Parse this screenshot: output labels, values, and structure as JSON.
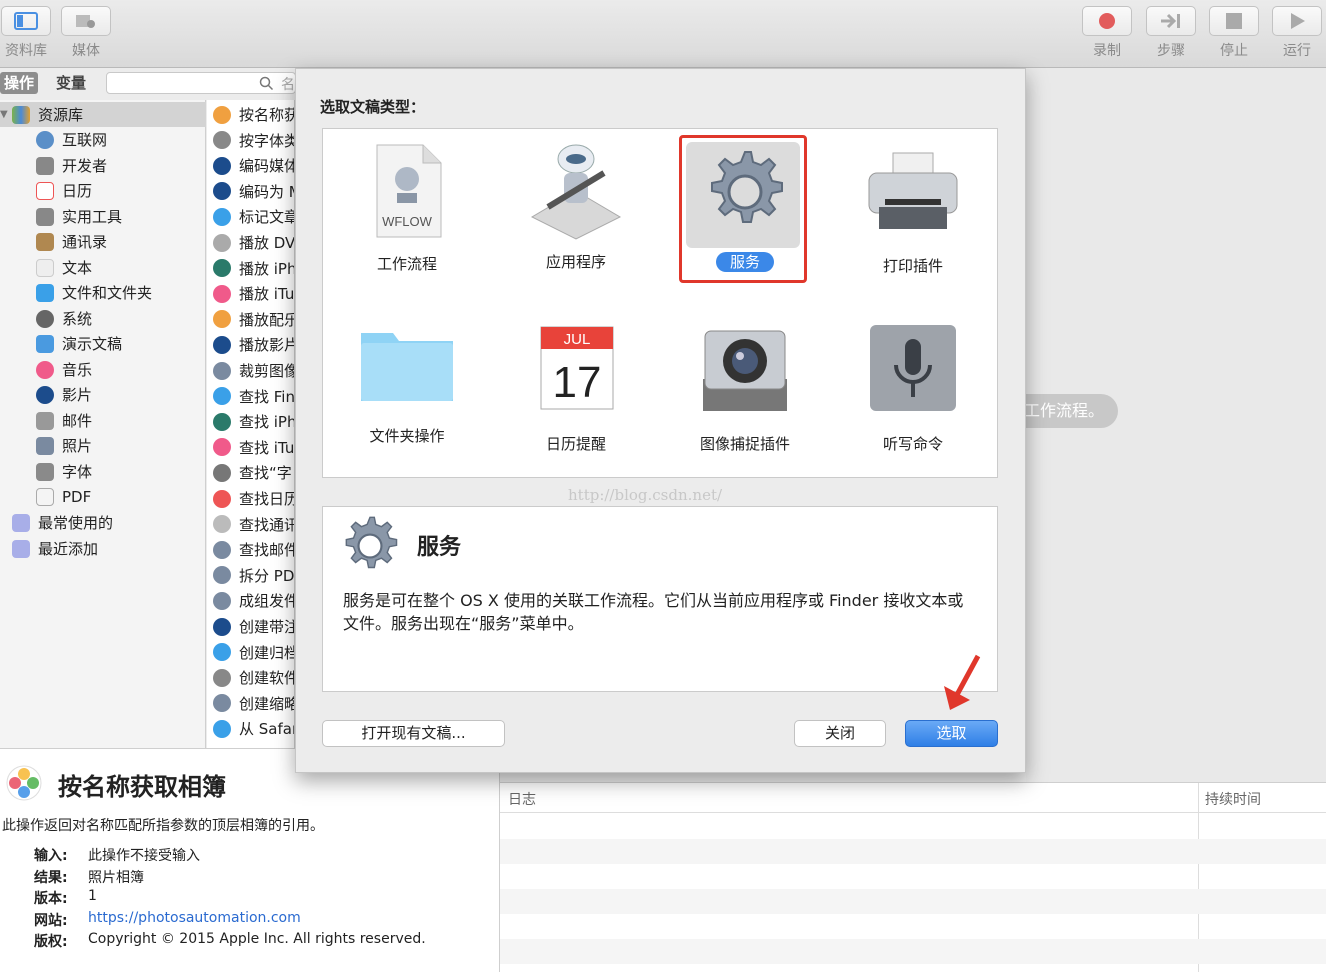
{
  "toolbar": {
    "left": [
      {
        "label": "资料库",
        "icon": "library-icon"
      },
      {
        "label": "媒体",
        "icon": "media-icon"
      }
    ],
    "right": [
      {
        "label": "录制",
        "icon": "record-icon"
      },
      {
        "label": "步骤",
        "icon": "step-icon"
      },
      {
        "label": "停止",
        "icon": "stop-icon"
      },
      {
        "label": "运行",
        "icon": "run-icon"
      }
    ]
  },
  "tabs": {
    "actions": "操作",
    "variables": "变量",
    "search_placeholder": "名"
  },
  "library": {
    "root": "资源库",
    "items": [
      "互联网",
      "开发者",
      "日历",
      "实用工具",
      "通讯录",
      "文本",
      "文件和文件夹",
      "系统",
      "演示文稿",
      "音乐",
      "影片",
      "邮件",
      "照片",
      "字体",
      "PDF"
    ],
    "groups": [
      "最常使用的",
      "最近添加"
    ]
  },
  "actions": [
    "按名称获",
    "按字体类",
    "编码媒体",
    "编码为 M",
    "标记文章",
    "播放 DV",
    "播放 iPh",
    "播放 iTu",
    "播放配乐",
    "播放影片",
    "裁剪图像",
    "查找 Fin",
    "查找 iPh",
    "查找 iTu",
    "查找“字",
    "查找日历",
    "查找通讯",
    "查找邮件",
    "拆分 PD",
    "成组发件",
    "创建带注",
    "创建归档",
    "创建软件",
    "创建缩略",
    "从 Safar"
  ],
  "info": {
    "title": "按名称获取相簿",
    "description": "此操作返回对名称匹配所指参数的顶层相簿的引用。",
    "rows": [
      {
        "key": "输入:",
        "value": "此操作不接受输入"
      },
      {
        "key": "结果:",
        "value": "照片相簿"
      },
      {
        "key": "版本:",
        "value": "1"
      },
      {
        "key": "网站:",
        "value": "https://photosautomation.com"
      },
      {
        "key": "版权:",
        "value": "Copyright © 2015 Apple Inc. All rights reserved."
      }
    ]
  },
  "log": {
    "col_log": "日志",
    "col_duration": "持续时间"
  },
  "main": {
    "hint": "工作流程。"
  },
  "sheet": {
    "heading": "选取文稿类型：",
    "types": [
      {
        "label": "工作流程",
        "icon": "workflow-document-icon",
        "badge": "WFLOW"
      },
      {
        "label": "应用程序",
        "icon": "automator-robot-icon"
      },
      {
        "label": "服务",
        "icon": "gear-icon",
        "selected": true
      },
      {
        "label": "打印插件",
        "icon": "printer-icon"
      },
      {
        "label": "文件夹操作",
        "icon": "folder-icon"
      },
      {
        "label": "日历提醒",
        "icon": "calendar-icon",
        "month": "JUL",
        "day": "17"
      },
      {
        "label": "图像捕捉插件",
        "icon": "camera-icon"
      },
      {
        "label": "听写命令",
        "icon": "microphone-icon"
      }
    ],
    "watermark": "http://blog.csdn.net/",
    "desc_title": "服务",
    "desc_text": "服务是可在整个 OS X 使用的关联工作流程。它们从当前应用程序或 Finder 接收文本或文件。服务出现在“服务”菜单中。",
    "open_button": "打开现有文稿...",
    "close_button": "关闭",
    "choose_button": "选取",
    "colors": {
      "accent": "#3b88e8",
      "highlight": "#e0372b"
    }
  }
}
